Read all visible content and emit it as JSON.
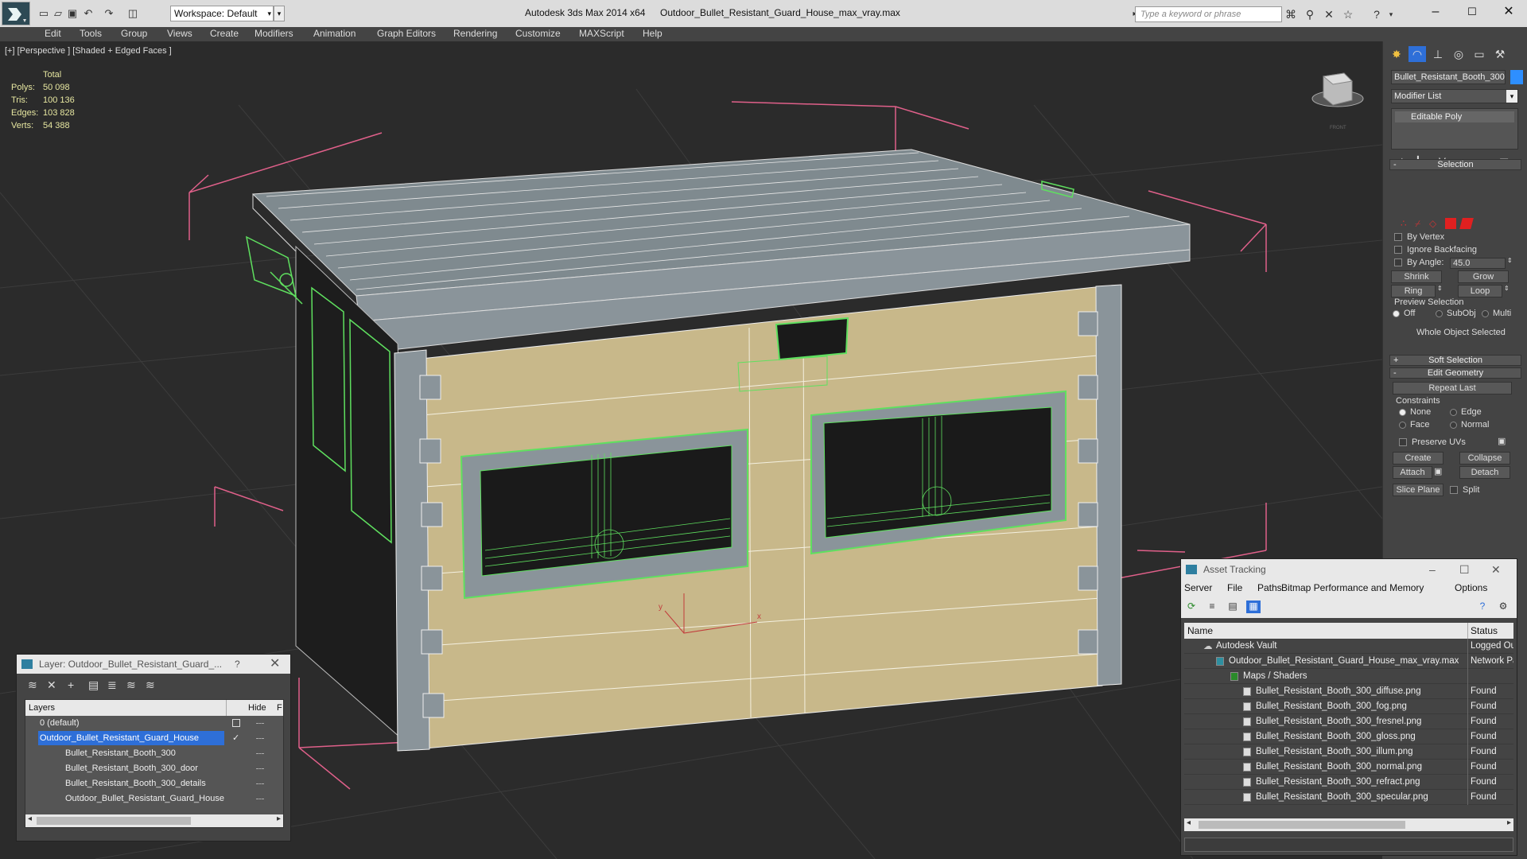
{
  "titlebar": {
    "workspace": "Workspace: Default",
    "app_title": "Autodesk 3ds Max  2014 x64",
    "file_title": "Outdoor_Bullet_Resistant_Guard_House_max_vray.max",
    "search_placeholder": "Type a keyword or phrase",
    "icons": [
      "new-file-icon",
      "open-icon",
      "save-icon",
      "undo-icon",
      "redo-icon",
      "project-icon",
      "binoculars-icon",
      "search-tools-icon",
      "cross-tools-icon",
      "star-icon",
      "help-icon"
    ]
  },
  "menu": [
    "Edit",
    "Tools",
    "Group",
    "Views",
    "Create",
    "Modifiers",
    "Animation",
    "Graph Editors",
    "Rendering",
    "Customize",
    "MAXScript",
    "Help"
  ],
  "viewport": {
    "label": "[+] [Perspective ] [Shaded + Edged Faces ]",
    "stats": {
      "header": "Total",
      "rows": [
        {
          "label": "Polys:",
          "value": "50 098"
        },
        {
          "label": "Tris:",
          "value": "100 136"
        },
        {
          "label": "Edges:",
          "value": "103 828"
        },
        {
          "label": "Verts:",
          "value": "54 388"
        }
      ]
    },
    "viewcube_label": "FRONT"
  },
  "command_panel": {
    "object_name": "Bullet_Resistant_Booth_300",
    "object_color": "#2e8fff",
    "modifier_list": "Modifier List",
    "stack_item": "Editable Poly",
    "selection": {
      "title": "Selection",
      "by_vertex": "By Vertex",
      "ignore_backfacing": "Ignore Backfacing",
      "by_angle": "By Angle:",
      "angle_value": "45.0",
      "shrink": "Shrink",
      "grow": "Grow",
      "ring": "Ring",
      "loop": "Loop",
      "preview_selection": "Preview Selection",
      "preview_off": "Off",
      "preview_subobj": "SubObj",
      "preview_multi": "Multi",
      "status": "Whole Object Selected"
    },
    "soft_selection": "Soft Selection",
    "edit_geometry": {
      "title": "Edit Geometry",
      "repeat_last": "Repeat Last",
      "constraints": "Constraints",
      "none": "None",
      "edge": "Edge",
      "face": "Face",
      "normal": "Normal",
      "preserve_uvs": "Preserve UVs",
      "create": "Create",
      "collapse": "Collapse",
      "attach": "Attach",
      "detach": "Detach",
      "slice_plane": "Slice Plane",
      "split": "Split"
    }
  },
  "layer_window": {
    "title": "Layer: Outdoor_Bullet_Resistant_Guard_...",
    "question": "?",
    "col_layers": "Layers",
    "col_hide": "Hide",
    "col_f": "F",
    "rows": [
      {
        "name": "0 (default)",
        "indent": 1,
        "selected": false
      },
      {
        "name": "Outdoor_Bullet_Resistant_Guard_House",
        "indent": 1,
        "selected": true
      },
      {
        "name": "Bullet_Resistant_Booth_300",
        "indent": 2,
        "selected": false
      },
      {
        "name": "Bullet_Resistant_Booth_300_door",
        "indent": 2,
        "selected": false
      },
      {
        "name": "Bullet_Resistant_Booth_300_details",
        "indent": 2,
        "selected": false
      },
      {
        "name": "Outdoor_Bullet_Resistant_Guard_House",
        "indent": 2,
        "selected": false
      }
    ]
  },
  "asset_window": {
    "title": "Asset Tracking",
    "menu": [
      "Server",
      "File",
      "Paths",
      "Bitmap Performance and Memory",
      "Options"
    ],
    "col_name": "Name",
    "col_status": "Status",
    "rows": [
      {
        "name": "Autodesk Vault",
        "status": "Logged Out",
        "indent": 1,
        "icon": "vault-icon"
      },
      {
        "name": "Outdoor_Bullet_Resistant_Guard_House_max_vray.max",
        "status": "Network Path",
        "indent": 2,
        "icon": "max-file-icon"
      },
      {
        "name": "Maps / Shaders",
        "status": "",
        "indent": 3,
        "icon": "maps-icon"
      },
      {
        "name": "Bullet_Resistant_Booth_300_diffuse.png",
        "status": "Found",
        "indent": 4,
        "icon": "bitmap-icon"
      },
      {
        "name": "Bullet_Resistant_Booth_300_fog.png",
        "status": "Found",
        "indent": 4,
        "icon": "bitmap-icon"
      },
      {
        "name": "Bullet_Resistant_Booth_300_fresnel.png",
        "status": "Found",
        "indent": 4,
        "icon": "bitmap-icon"
      },
      {
        "name": "Bullet_Resistant_Booth_300_gloss.png",
        "status": "Found",
        "indent": 4,
        "icon": "bitmap-icon"
      },
      {
        "name": "Bullet_Resistant_Booth_300_illum.png",
        "status": "Found",
        "indent": 4,
        "icon": "bitmap-icon"
      },
      {
        "name": "Bullet_Resistant_Booth_300_normal.png",
        "status": "Found",
        "indent": 4,
        "icon": "bitmap-icon"
      },
      {
        "name": "Bullet_Resistant_Booth_300_refract.png",
        "status": "Found",
        "indent": 4,
        "icon": "bitmap-icon"
      },
      {
        "name": "Bullet_Resistant_Booth_300_specular.png",
        "status": "Found",
        "indent": 4,
        "icon": "bitmap-icon"
      }
    ]
  },
  "colors": {
    "wireframe_selected": "#5fe05f",
    "bounding_box": "#e0608a",
    "wall_fill": "#c8b88a",
    "frame_fill": "#8a949a",
    "stats_text": "#e6e6a0",
    "selection_highlight": "#2e6fd8"
  }
}
